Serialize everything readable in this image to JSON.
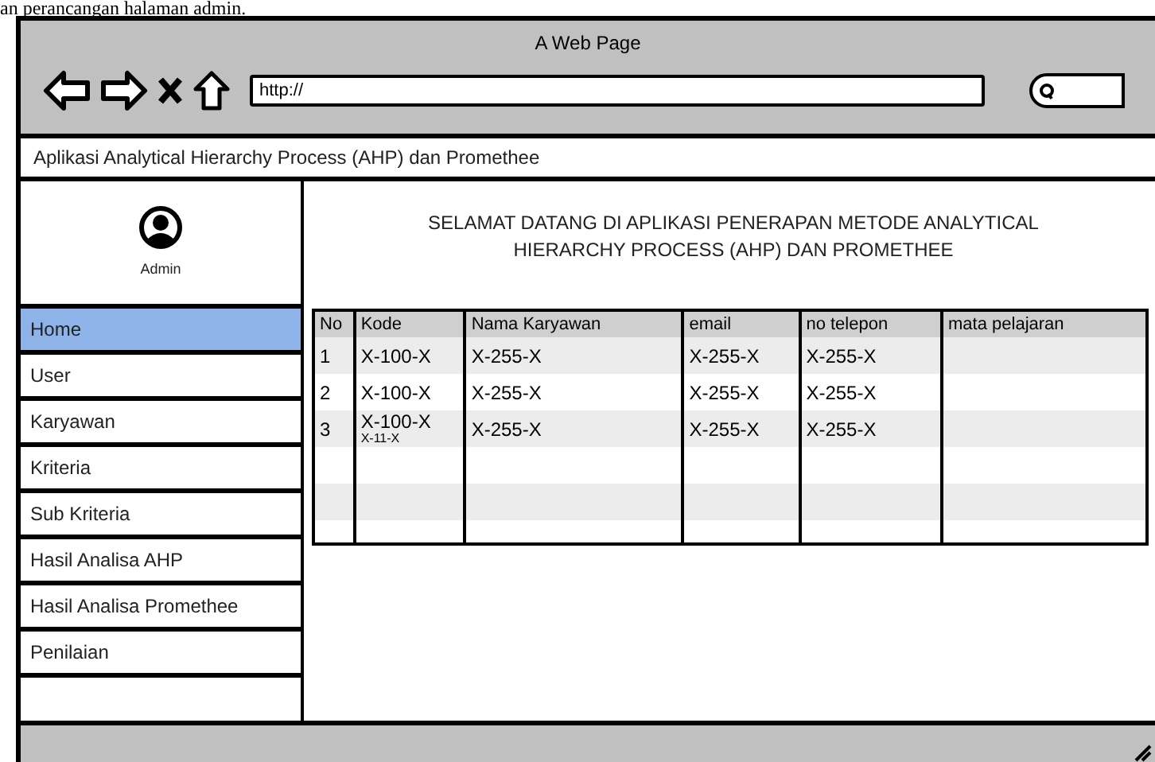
{
  "caption": "an perancangan halaman admin.",
  "window": {
    "title": "A Web Page",
    "url": "http://"
  },
  "app_title": "Aplikasi Analytical Hierarchy Process (AHP) dan Promethee",
  "user": {
    "name": "Admin"
  },
  "sidebar": {
    "items": [
      {
        "label": "Home",
        "selected": true
      },
      {
        "label": "User",
        "selected": false
      },
      {
        "label": "Karyawan",
        "selected": false
      },
      {
        "label": "Kriteria",
        "selected": false
      },
      {
        "label": "Sub Kriteria",
        "selected": false
      },
      {
        "label": "Hasil Analisa AHP",
        "selected": false
      },
      {
        "label": "Hasil Analisa Promethee",
        "selected": false
      },
      {
        "label": "Penilaian",
        "selected": false
      }
    ]
  },
  "welcome": "SELAMAT DATANG DI APLIKASI PENERAPAN METODE ANALYTICAL HIERARCHY PROCESS (AHP) DAN PROMETHEE",
  "table": {
    "columns": [
      "No",
      "Kode",
      "Nama Karyawan",
      "email",
      "no telepon",
      "mata pelajaran"
    ],
    "rows": [
      {
        "cells": [
          "1",
          "X-100-X",
          "X-255-X",
          "X-255-X",
          "X-255-X",
          ""
        ]
      },
      {
        "cells": [
          "2",
          "X-100-X",
          "X-255-X",
          "X-255-X",
          "X-255-X",
          ""
        ]
      },
      {
        "cells": [
          "3",
          "X-100-X",
          "X-255-X",
          "X-255-X",
          "X-255-X",
          ""
        ],
        "overlay": "X-11-X"
      }
    ]
  }
}
